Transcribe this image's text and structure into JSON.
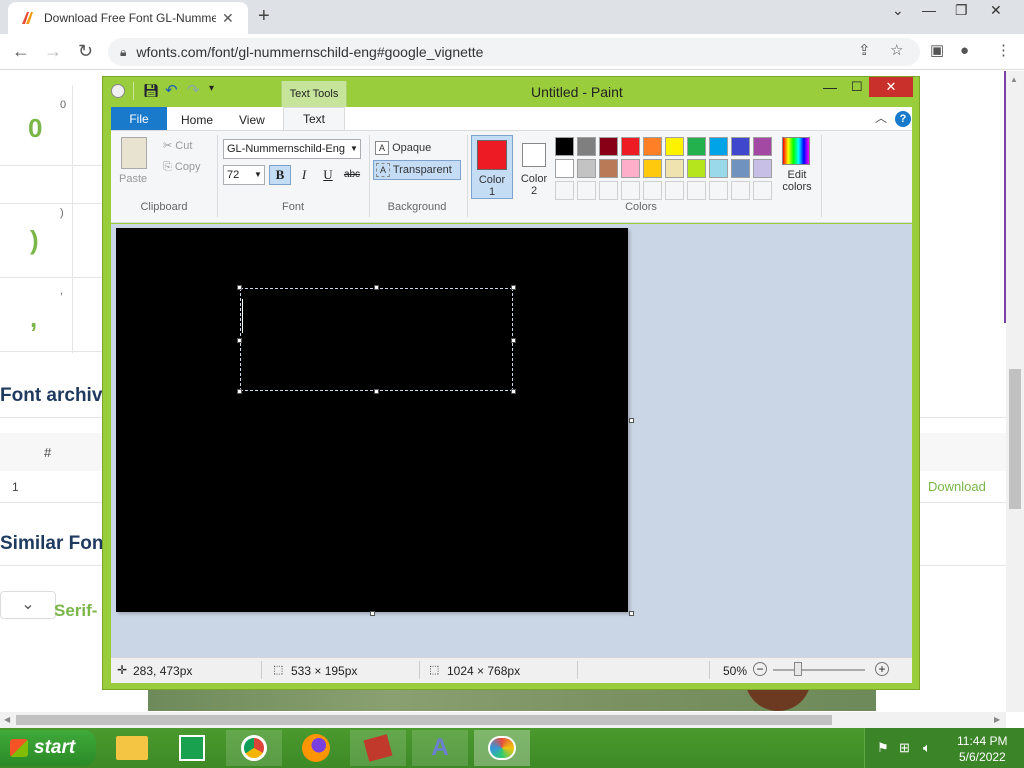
{
  "browser": {
    "tab_title": "Download Free Font GL-Numme",
    "url": "wfonts.com/font/gl-nummernschild-eng#google_vignette"
  },
  "webpage": {
    "glyph_rows": [
      {
        "code": "0",
        "glyph": "0"
      },
      {
        "code": ")",
        "glyph": ")"
      },
      {
        "code": ",",
        "glyph": ","
      }
    ],
    "font_archive_heading": "Font archive",
    "table_header_num": "#",
    "table_row_num": "1",
    "download_link": "Download",
    "similar_heading": "Similar Font",
    "serif_link": "Serif-"
  },
  "paint": {
    "title": "Untitled - Paint",
    "contextual_tab": "Text Tools",
    "tabs": [
      "File",
      "Home",
      "View",
      "Text"
    ],
    "clipboard": {
      "paste": "Paste",
      "cut": "Cut",
      "copy": "Copy",
      "group": "Clipboard"
    },
    "font": {
      "family": "GL-Nummernschild-Eng",
      "size": "72",
      "group": "Font"
    },
    "format_buttons": {
      "bold": "B",
      "italic": "I",
      "underline": "U",
      "strike": "abc"
    },
    "background": {
      "opaque": "Opaque",
      "transparent": "Transparent",
      "group": "Background"
    },
    "color1": {
      "label1": "Color",
      "label2": "1",
      "value": "#ed1c24"
    },
    "color2": {
      "label1": "Color",
      "label2": "2",
      "value": "#ffffff"
    },
    "palette_row1": [
      "#000000",
      "#7f7f7f",
      "#880015",
      "#ed1c24",
      "#ff7f27",
      "#fff200",
      "#22b14c",
      "#00a2e8",
      "#3f48cc",
      "#a349a4"
    ],
    "palette_row2": [
      "#ffffff",
      "#c3c3c3",
      "#b97a57",
      "#ffaec9",
      "#ffc90e",
      "#efe4b0",
      "#b5e61d",
      "#99d9ea",
      "#7092be",
      "#c8bfe7"
    ],
    "colors_group": "Colors",
    "edit_colors": {
      "line1": "Edit",
      "line2": "colors"
    },
    "status": {
      "cursor": "283, 473px",
      "selection": "533 × 195px",
      "image_size": "1024 × 768px",
      "zoom": "50%"
    }
  },
  "taskbar": {
    "start": "start",
    "time": "11:44 PM",
    "date": "5/6/2022"
  }
}
